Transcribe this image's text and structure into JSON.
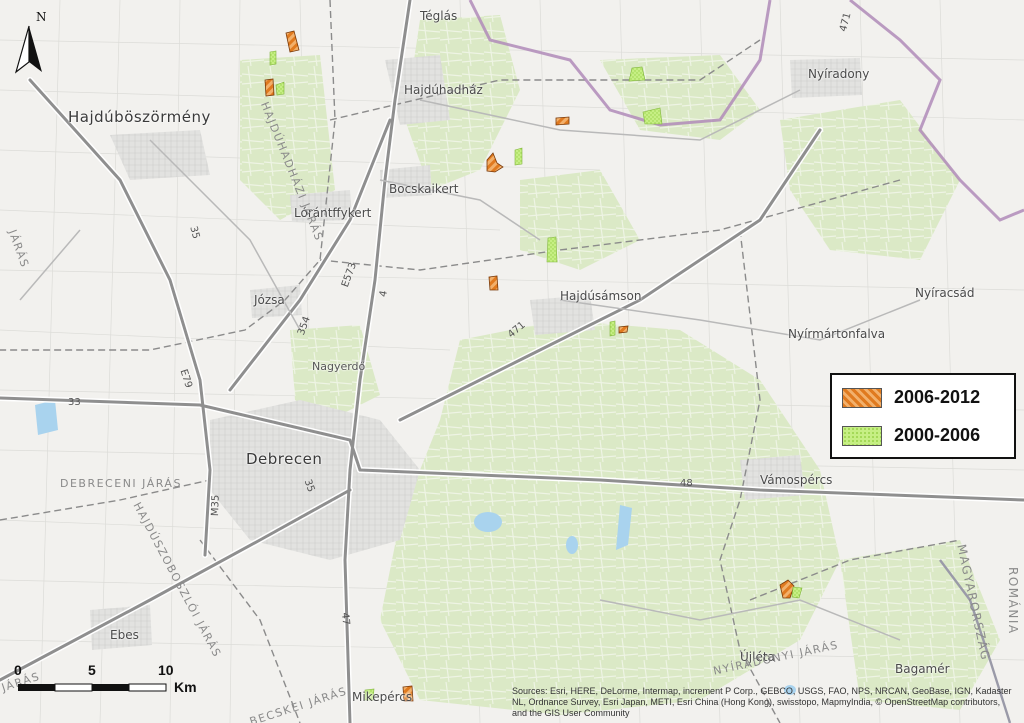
{
  "places": [
    {
      "id": "teglas",
      "name": "Téglás"
    },
    {
      "id": "hajduhadhaz",
      "name": "Hajdúhadház"
    },
    {
      "id": "nyiradony",
      "name": "Nyíradony"
    },
    {
      "id": "hajduboszormeny",
      "name": "Hajdúböszörmény"
    },
    {
      "id": "bocskaikert",
      "name": "Bocskaikert"
    },
    {
      "id": "lorantffykert",
      "name": "Lórántffykert"
    },
    {
      "id": "jozsa",
      "name": "Józsa"
    },
    {
      "id": "hajdusamson",
      "name": "Hajdúsámson"
    },
    {
      "id": "nyiracsad",
      "name": "Nyíracsád"
    },
    {
      "id": "nyirmartonfalva",
      "name": "Nyírmártonfalva"
    },
    {
      "id": "nagyerdo",
      "name": "Nagyerdő"
    },
    {
      "id": "debrecen",
      "name": "Debrecen"
    },
    {
      "id": "vamospercs",
      "name": "Vámospércs"
    },
    {
      "id": "ebes",
      "name": "Ebes"
    },
    {
      "id": "ujleta",
      "name": "Újléta"
    },
    {
      "id": "bagamer",
      "name": "Bagamér"
    },
    {
      "id": "mikepercs",
      "name": "Mikepércs"
    }
  ],
  "districts": [
    {
      "id": "hajduhadhazi",
      "name": "HAJDÚHADHÁZI JÁRÁS"
    },
    {
      "id": "debreceni",
      "name": "DEBRECENI JÁRÁS"
    },
    {
      "id": "hajduszoboszloi",
      "name": "HAJDÚSZOBOSZLÓI JÁRÁS"
    },
    {
      "id": "nyiradonyi",
      "name": "NYÍRADONYI JÁRÁS"
    },
    {
      "id": "becskei",
      "name": "BECSKEI JÁRÁS"
    },
    {
      "id": "jaras_left",
      "name": "JÁRÁS"
    },
    {
      "id": "jaras_bottomleft",
      "name": "JÁRÁS"
    },
    {
      "id": "romania",
      "name": "ROMÁNIA"
    },
    {
      "id": "magyarorszag",
      "name": "MAGYARORSZÁG"
    }
  ],
  "roads": [
    {
      "id": "r35a",
      "name": "35"
    },
    {
      "id": "r35b",
      "name": "35"
    },
    {
      "id": "r33",
      "name": "33"
    },
    {
      "id": "r354",
      "name": "354"
    },
    {
      "id": "re573",
      "name": "E573"
    },
    {
      "id": "r4",
      "name": "4"
    },
    {
      "id": "re79",
      "name": "E79"
    },
    {
      "id": "r471a",
      "name": "471"
    },
    {
      "id": "r471b",
      "name": "471"
    },
    {
      "id": "r48",
      "name": "48"
    },
    {
      "id": "rm35",
      "name": "M35"
    },
    {
      "id": "r47",
      "name": "47"
    }
  ],
  "legend": {
    "items": [
      {
        "label": "2006-2012",
        "pattern": "orange-hatch",
        "color": "#e07a1f"
      },
      {
        "label": "2000-2006",
        "pattern": "green-stipple",
        "color": "#b9e86a"
      }
    ]
  },
  "scalebar": {
    "ticks": [
      "0",
      "5",
      "10"
    ],
    "unit": "Km"
  },
  "north_arrow": {
    "label": "N"
  },
  "attribution": "Sources: Esri, HERE, DeLorme, Intermap, increment P Corp., GEBCO, USGS, FAO, NPS, NRCAN, GeoBase, IGN, Kadaster NL, Ordnance Survey, Esri Japan, METI, Esri China (Hong Kong), swisstopo, MapmyIndia, © OpenStreetMap contributors, and the GIS User Community",
  "colors": {
    "background": "#f2f1ee",
    "forest": "#dbe9c6",
    "urban": "#dcdcdc",
    "major_road": "#9a9a9a",
    "border": "#b08bb8",
    "water": "#a9d3ee",
    "hatch_orange": "#e07a1f",
    "stipple_green": "#b9e86a"
  }
}
